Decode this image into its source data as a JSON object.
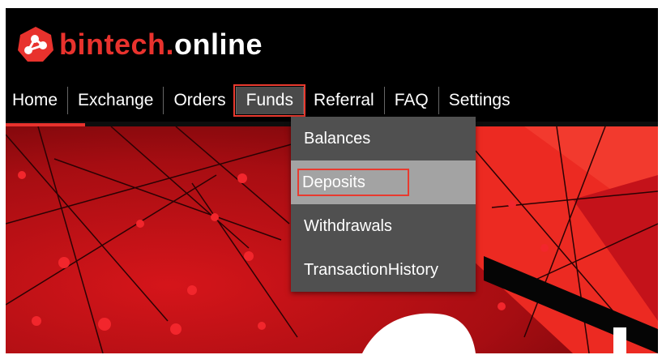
{
  "brand": {
    "part1": "bintech.",
    "part2": "online"
  },
  "nav": [
    {
      "label": "Home"
    },
    {
      "label": "Exchange"
    },
    {
      "label": "Orders"
    },
    {
      "label": "Funds"
    },
    {
      "label": "Referral"
    },
    {
      "label": "FAQ"
    },
    {
      "label": "Settings"
    }
  ],
  "dropdown": {
    "items": [
      {
        "label": "Balances"
      },
      {
        "label": "Deposits"
      },
      {
        "label": "Withdrawals"
      },
      {
        "label": "TransactionHistory"
      }
    ]
  },
  "colors": {
    "brand_red": "#e8322d",
    "highlight": "#e83a2f",
    "menu_bg": "#505050",
    "menu_selected": "#a3a3a3"
  },
  "icons": {
    "logo": "network-nodes-logo"
  }
}
